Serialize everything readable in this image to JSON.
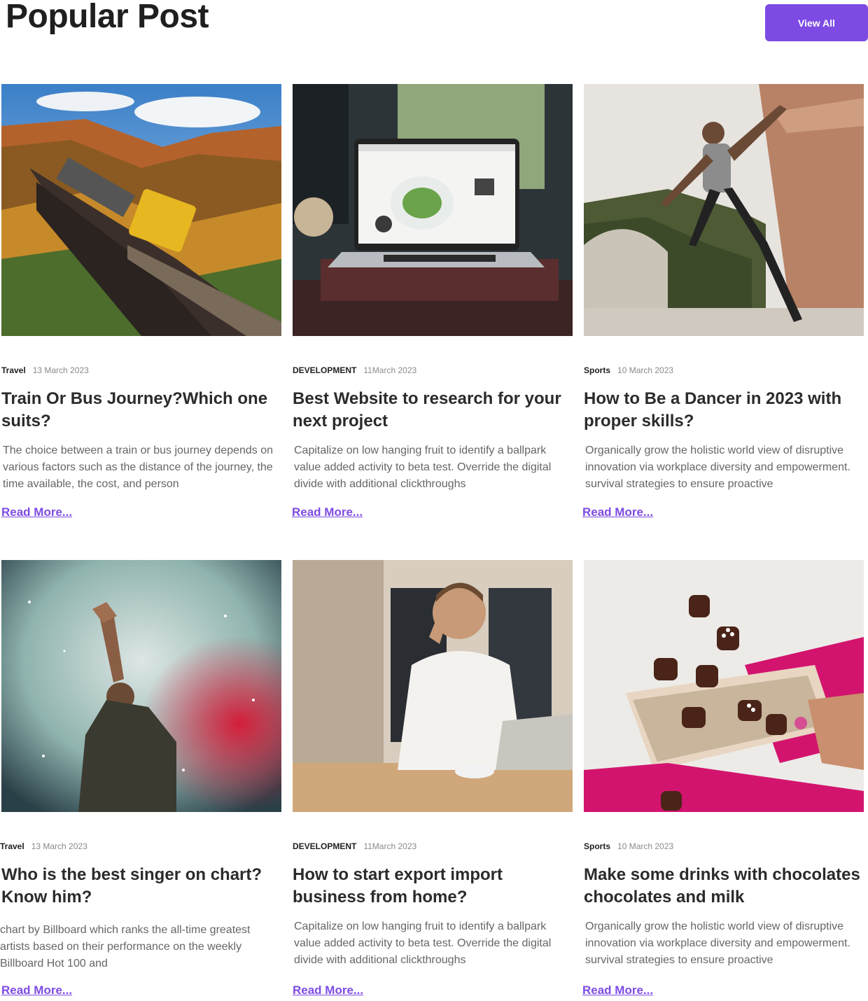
{
  "header": {
    "title": "Popular Post",
    "view_all_label": "View All"
  },
  "colors": {
    "accent": "#7d4be3",
    "title_text": "#2b2b2b",
    "body_text": "#666666",
    "date_text": "#8a8a8a"
  },
  "posts": [
    {
      "category": "Travel",
      "date": "13 March 2023",
      "title": "Train Or Bus Journey?Which one suits?",
      "excerpt": "The choice between a train or bus journey depends on various factors such as the distance of the journey, the time available, the cost, and person",
      "read_more": "Read More...",
      "image": "train-photo"
    },
    {
      "category": "DEVELOPMENT",
      "date": "11March 2023",
      "title": "Best Website to research for your next project",
      "excerpt": "Capitalize on low hanging fruit to identify a ballpark value added activity to beta test. Override the digital divide with additional clickthroughs",
      "read_more": "Read More...",
      "image": "laptop-photo"
    },
    {
      "category": "Sports",
      "date": "10 March 2023",
      "title": "How to Be a Dancer in 2023 with proper skills?",
      "excerpt": "Organically grow the holistic world view of disruptive innovation via workplace diversity and empowerment. survival strategies to ensure proactive",
      "read_more": "Read More...",
      "image": "dancer-photo"
    },
    {
      "category": "Travel",
      "date": "13 March 2023",
      "title": "Who is the best singer on chart? Know him?",
      "excerpt": "chart by Billboard which ranks the all-time greatest artists based on their performance on the weekly Billboard Hot 100 and",
      "read_more": "Read More...",
      "image": "singer-photo"
    },
    {
      "category": "DEVELOPMENT",
      "date": "11March 2023",
      "title": "How to start export import business from home?",
      "excerpt": "Capitalize on low hanging fruit to identify a ballpark value added activity to beta test. Override the digital divide with additional clickthroughs",
      "read_more": "Read More...",
      "image": "businessman-photo"
    },
    {
      "category": "Sports",
      "date": "10 March 2023",
      "title": "Make some drinks with chocolates chocolates and milk",
      "excerpt": "Organically grow the holistic world view of disruptive innovation via workplace diversity and empowerment. survival strategies to ensure proactive",
      "read_more": "Read More...",
      "image": "chocolates-photo"
    }
  ]
}
